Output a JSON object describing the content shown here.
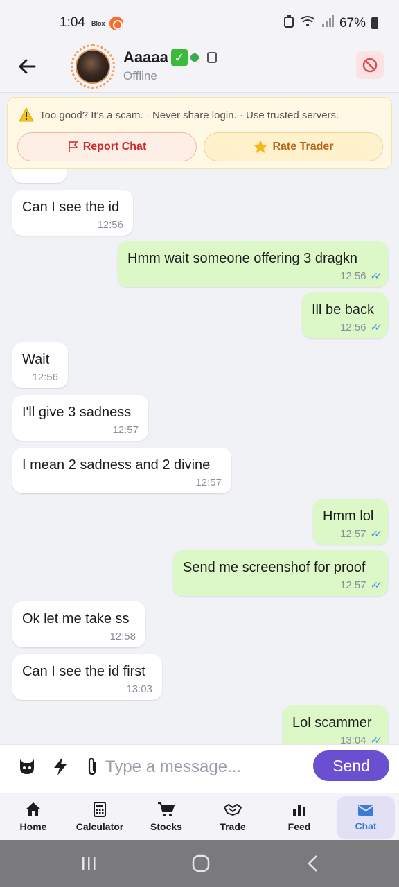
{
  "status_bar": {
    "time": "1:04",
    "app_label": "Blox",
    "battery": "67%"
  },
  "header": {
    "contact_name": "Aaaaa",
    "status": "Offline"
  },
  "warning": {
    "text": "Too good? It's a scam. · Never share login. · Use trusted servers.",
    "report_label": "Report Chat",
    "rate_label": "Rate Trader"
  },
  "messages": [
    {
      "dir": "recv",
      "text": "Can I see the id",
      "time": "12:56"
    },
    {
      "dir": "sent",
      "text": "Hmm wait someone offering 3 dragkn",
      "time": "12:56"
    },
    {
      "dir": "sent",
      "text": "Ill be back",
      "time": "12:56"
    },
    {
      "dir": "recv",
      "text": "Wait",
      "time": "12:56"
    },
    {
      "dir": "recv",
      "text": "I'll give 3 sadness",
      "time": "12:57"
    },
    {
      "dir": "recv",
      "text": "I mean 2 sadness and 2 divine",
      "time": "12:57"
    },
    {
      "dir": "sent",
      "text": "Hmm lol",
      "time": "12:57"
    },
    {
      "dir": "sent",
      "text": "Send me screenshof for proof",
      "time": "12:57"
    },
    {
      "dir": "recv",
      "text": "Ok let me take ss",
      "time": "12:58"
    },
    {
      "dir": "recv",
      "text": "Can I see the id first",
      "time": "13:03"
    },
    {
      "dir": "sent",
      "text": "Lol scammer",
      "time": "13:04"
    }
  ],
  "composer": {
    "placeholder": "Type a message...",
    "send_label": "Send"
  },
  "bottom_nav": {
    "items": [
      {
        "label": "Home",
        "icon": "home-icon"
      },
      {
        "label": "Calculator",
        "icon": "calculator-icon"
      },
      {
        "label": "Stocks",
        "icon": "cart-icon"
      },
      {
        "label": "Trade",
        "icon": "handshake-icon"
      },
      {
        "label": "Feed",
        "icon": "bar-chart-icon"
      },
      {
        "label": "Chat",
        "icon": "mail-icon"
      }
    ],
    "active": "Chat"
  },
  "colors": {
    "sent_bubble": "#dcf8c6",
    "received_bubble": "#ffffff",
    "send_button": "#6a4fd0",
    "report_text": "#cc2a2a",
    "rate_text": "#b8651a"
  }
}
